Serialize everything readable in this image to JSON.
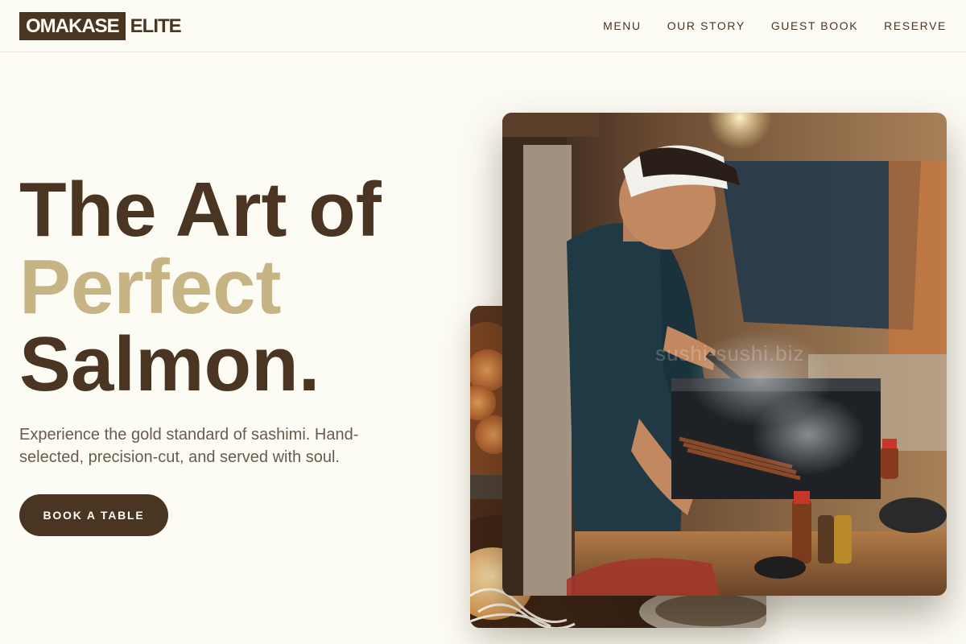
{
  "brand": {
    "boxed": "OMAKASE",
    "plain": "ELITE"
  },
  "nav": [
    {
      "label": "MENU"
    },
    {
      "label": "OUR STORY"
    },
    {
      "label": "GUEST BOOK"
    },
    {
      "label": "RESERVE"
    }
  ],
  "hero": {
    "line1": "The Art of",
    "line2": "Perfect",
    "line3": "Salmon.",
    "subtitle": "Experience the gold standard of sashimi. Hand-selected, precision-cut, and served with soul.",
    "cta": "BOOK A TABLE"
  },
  "images": {
    "front_watermark": "sushi-sushi.biz",
    "front_subject": "chef grilling yakitori skewers",
    "back_subject": "plated japanese dishes"
  },
  "colors": {
    "background": "#fdfcf4",
    "primary": "#4a3422",
    "accent": "#c7b484",
    "body_text": "#6a5a4c"
  }
}
